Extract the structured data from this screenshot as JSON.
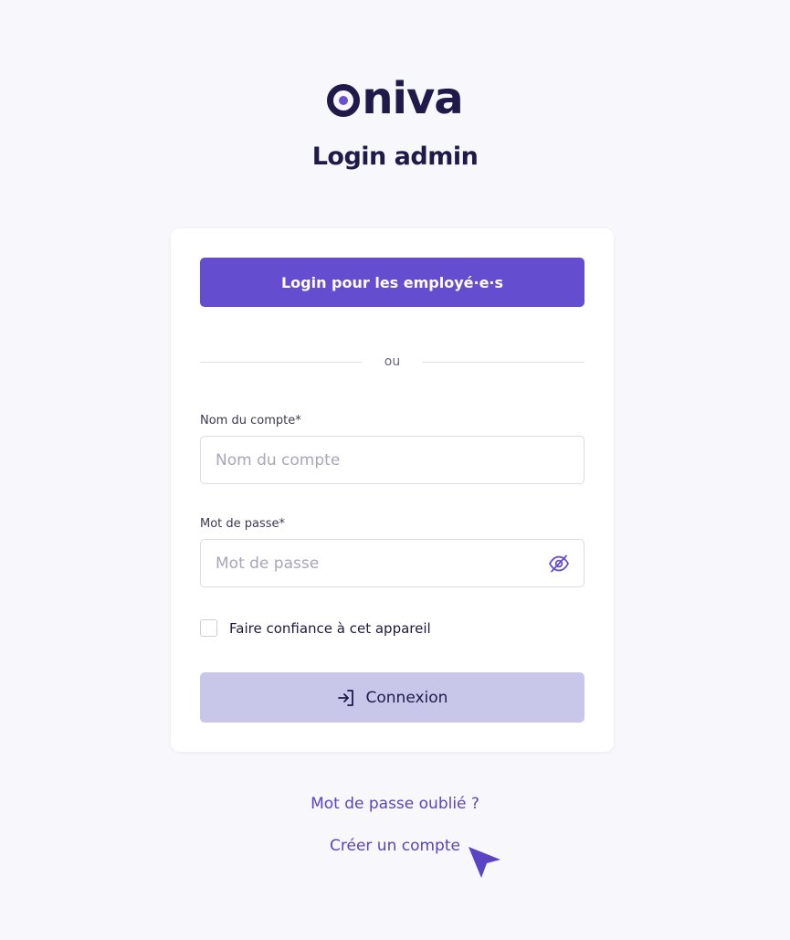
{
  "brand": {
    "name_rest": "niva",
    "color": "#1f1a4a",
    "accent": "#6b4fd6"
  },
  "page_title": "Login admin",
  "sso_button": {
    "label": "Login pour les employé·e·s",
    "color": "#654dd0"
  },
  "divider_text": "ou",
  "account_field": {
    "label": "Nom du compte*",
    "placeholder": "Nom du compte",
    "value": ""
  },
  "password_field": {
    "label": "Mot de passe*",
    "placeholder": "Mot de passe",
    "value": "",
    "toggle_icon": "eye-off-icon"
  },
  "trust_device": {
    "label": "Faire confiance à cet appareil",
    "checked": false
  },
  "submit_button": {
    "label": "Connexion",
    "icon": "login-icon",
    "color": "#c8c7ea"
  },
  "links": {
    "forgot_password": "Mot de passe oublié ?",
    "create_account": "Créer un compte",
    "color": "#5b44c4"
  },
  "cursor": {
    "icon": "pointer-arrow-icon",
    "color": "#5b44c4"
  }
}
